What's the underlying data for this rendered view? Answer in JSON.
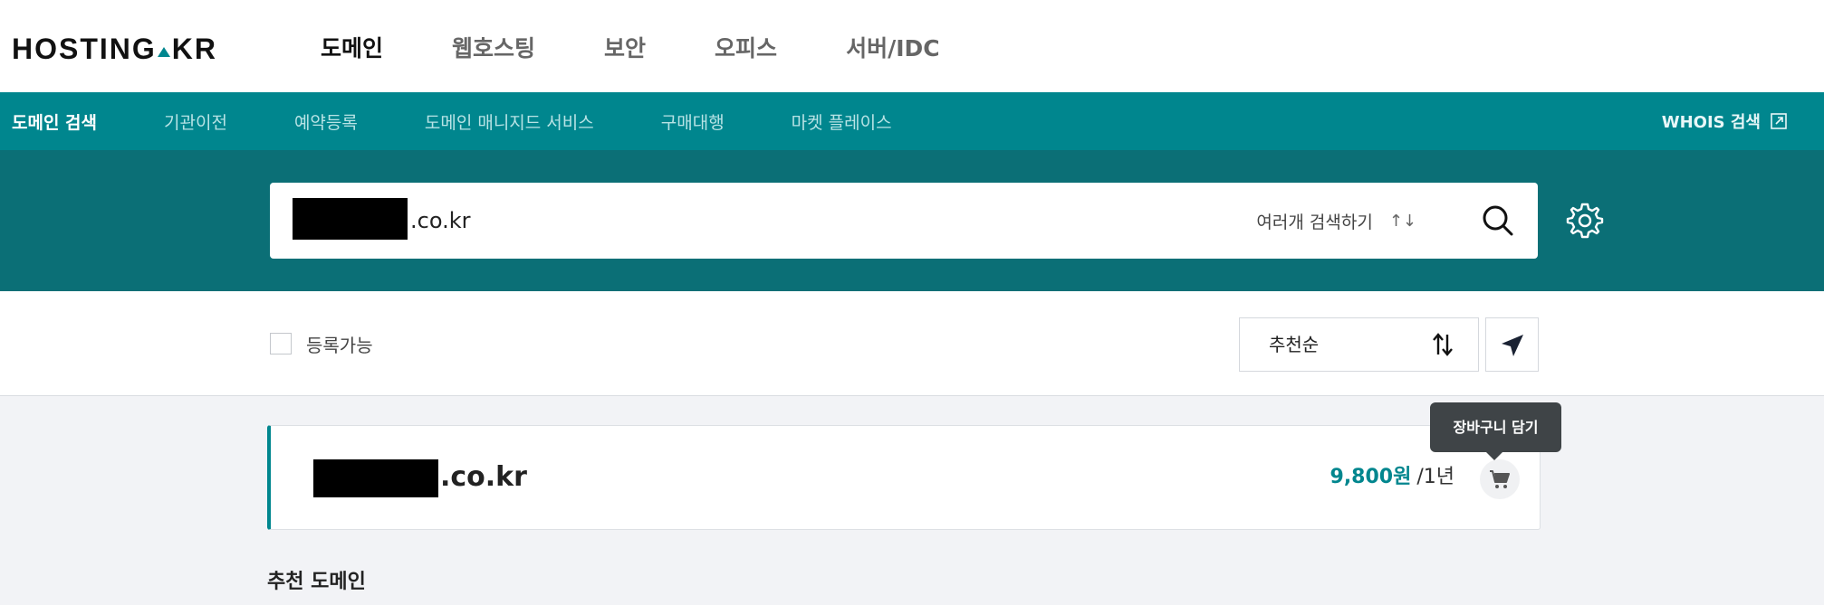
{
  "header": {
    "logo_text": "HOSTING",
    "logo_suffix": "KR",
    "gnb": [
      "도메인",
      "웹호스팅",
      "보안",
      "오피스",
      "서버/IDC"
    ]
  },
  "subnav": {
    "items": [
      "도메인 검색",
      "기관이전",
      "예약등록",
      "도메인 매니지드 서비스",
      "구매대행",
      "마켓 플레이스"
    ],
    "whois_label": "WHOIS 검색"
  },
  "search": {
    "value_suffix": ".co.kr",
    "multi_search_label": "여러개 검색하기",
    "multi_search_arrows": "↑↓"
  },
  "filters": {
    "available_label": "등록가능",
    "sort_value": "추천순"
  },
  "result": {
    "domain_suffix": ".co.kr",
    "price": "9,800원",
    "period": "/1년"
  },
  "tooltip": "장바구니 담기",
  "recommended_title": "추천 도메인",
  "colors": {
    "brand_teal": "#00868e",
    "search_band": "#0b6f76"
  }
}
